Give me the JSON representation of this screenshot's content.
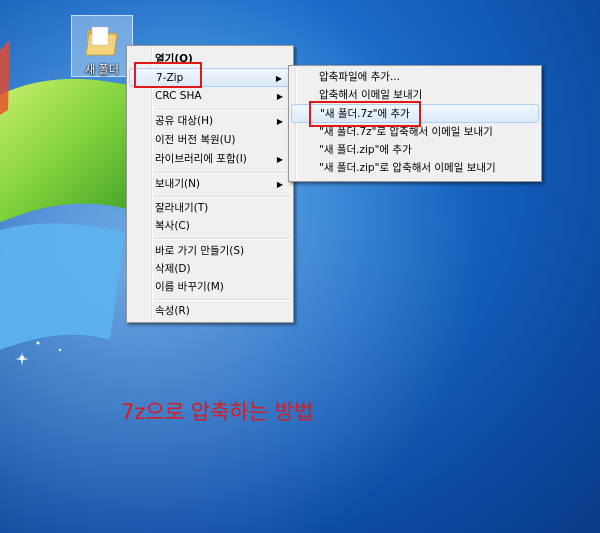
{
  "desktop": {
    "icon_label": "새 폴더",
    "icon": "folder-icon"
  },
  "context_menu": {
    "items": [
      {
        "label": "열기(O)",
        "bold": true
      },
      {
        "label": "7-Zip",
        "submenu": true
      },
      {
        "label": "CRC SHA",
        "submenu": true
      },
      {
        "label": "공유 대상(H)",
        "submenu": true
      },
      {
        "label": "이전 버전 복원(U)"
      },
      {
        "label": "라이브러리에 포함(I)",
        "submenu": true
      },
      {
        "label": "보내기(N)",
        "submenu": true
      },
      {
        "label": "잘라내기(T)"
      },
      {
        "label": "복사(C)"
      },
      {
        "label": "바로 가기 만들기(S)"
      },
      {
        "label": "삭제(D)"
      },
      {
        "label": "이름 바꾸기(M)"
      },
      {
        "label": "속성(R)"
      }
    ]
  },
  "submenu_7zip": {
    "items": [
      {
        "label": "압축파일에 추가..."
      },
      {
        "label": "압축해서 이메일 보내기"
      },
      {
        "label": "\"새 폴더.7z\"에 추가"
      },
      {
        "label": "\"새 폴더.7z\"로 압축해서 이메일 보내기"
      },
      {
        "label": "\"새 폴더.zip\"에 추가"
      },
      {
        "label": "\"새 폴더.zip\"로 압축해서 이메일 보내기"
      }
    ]
  },
  "caption": "7z으로 압축하는 방법",
  "colors": {
    "highlight_box": "#e01818",
    "caption": "#e01818"
  }
}
